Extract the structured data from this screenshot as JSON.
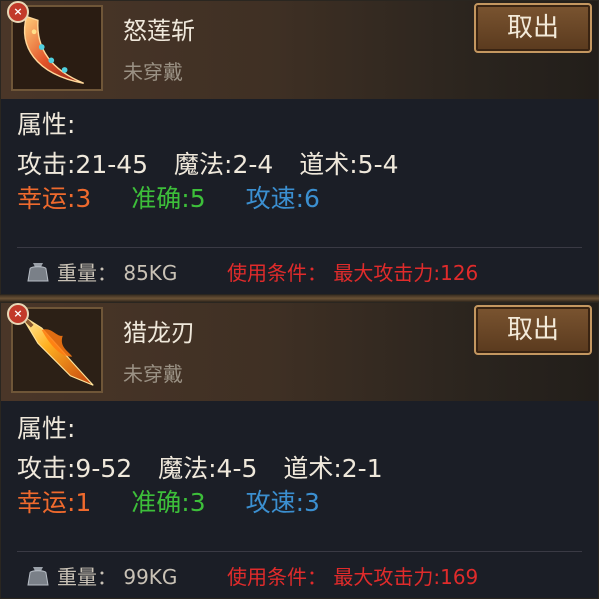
{
  "colors": {
    "luck": "#ef6a2d",
    "accuracy": "#3dbf3a",
    "attack_speed": "#3b8fd0",
    "condition": "#e02b2b"
  },
  "items": [
    {
      "name": "怒莲斩",
      "equip_status": "未穿戴",
      "take_button": "取出",
      "icon": "crescent-blade-icon",
      "attr_title": "属性:",
      "attack": "攻击:21-45",
      "magic": "魔法:2-4",
      "taoism": "道术:5-4",
      "luck": "幸运:3",
      "accuracy": "准确:5",
      "attack_speed": "攻速:6",
      "weight": "重量：  85KG",
      "condition": "使用条件：  最大攻击力:126"
    },
    {
      "name": "猎龙刃",
      "equip_status": "未穿戴",
      "take_button": "取出",
      "icon": "flame-blade-icon",
      "attr_title": "属性:",
      "attack": "攻击:9-52",
      "magic": "魔法:4-5",
      "taoism": "道术:2-1",
      "luck": "幸运:1",
      "accuracy": "准确:3",
      "attack_speed": "攻速:3",
      "weight": "重量：  99KG",
      "condition": "使用条件：  最大攻击力:169"
    }
  ]
}
